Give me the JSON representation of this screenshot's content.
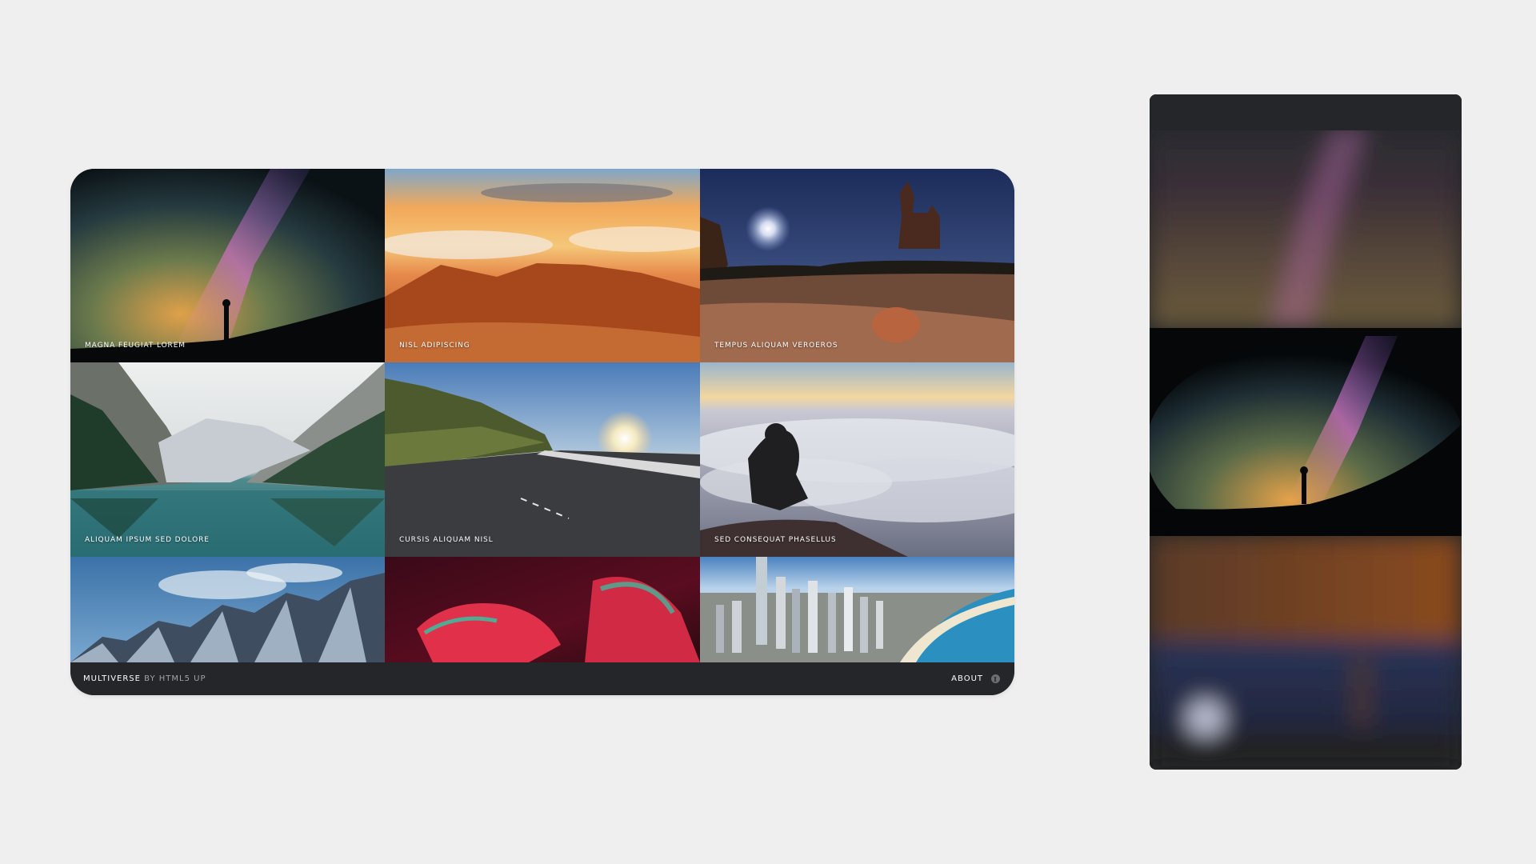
{
  "gallery": {
    "items": [
      {
        "caption": "Magna feugiat lorem"
      },
      {
        "caption": "Nisl adipiscing"
      },
      {
        "caption": "Tempus aliquam veroeros"
      },
      {
        "caption": "Aliquam ipsum sed dolore"
      },
      {
        "caption": "Cursis aliquam nisl"
      },
      {
        "caption": "Sed consequat phasellus"
      },
      {
        "caption": ""
      },
      {
        "caption": ""
      },
      {
        "caption": ""
      }
    ]
  },
  "footer": {
    "brand_name": "Multiverse",
    "brand_by": "by HTML5 UP",
    "about_label": "About"
  },
  "colors": {
    "page_background": "#efefef",
    "frame_background": "#242629",
    "footer_text": "#ffffff",
    "footer_muted": "#a0a3a8"
  }
}
